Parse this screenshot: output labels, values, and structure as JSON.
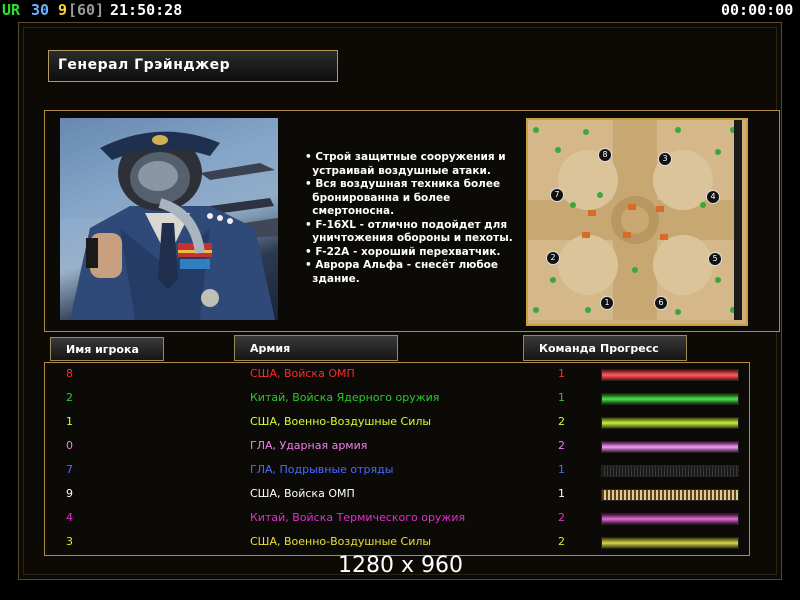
{
  "topbar": {
    "ur_label": "UR",
    "fps": "30",
    "frames": "9",
    "frames_cap": "[60]",
    "clock": "21:50:28",
    "timer": "00:00:00"
  },
  "general": {
    "name": "Генерал Грэйнджер",
    "description_lines": [
      "• Строй защитные сооружения и",
      "  устраивай воздушные атаки.",
      "• Вся воздушная техника более",
      "  бронированна и более",
      "  смертоносна.",
      "• F-16XL - отлично подойдет для",
      "  уничтожения обороны и пехоты.",
      "• F-22A - хороший перехватчик.",
      "• Аврора Альфа - снесёт любое",
      "  здание."
    ]
  },
  "map": {
    "slots": [
      "1",
      "2",
      "3",
      "4",
      "5",
      "6",
      "7",
      "8"
    ]
  },
  "table": {
    "headers": {
      "player": "Имя игрока",
      "army": "Армия",
      "team": "Команда",
      "progress": "Прогресс"
    },
    "rows": [
      {
        "name": "8",
        "army": "США, Войска ОМП",
        "team": "1",
        "color": "#ff2a2a",
        "progress_style": "red"
      },
      {
        "name": "2",
        "army": "Китай, Войска Ядерного оружия",
        "team": "1",
        "color": "#2ec82e",
        "progress_style": "green"
      },
      {
        "name": "1",
        "army": "США, Военно-Воздушные Силы",
        "team": "2",
        "color": "#d8ff30",
        "progress_style": "lime"
      },
      {
        "name": "0",
        "army": "ГЛА, Ударная армия",
        "team": "2",
        "color": "#f07ef0",
        "progress_style": "pink"
      },
      {
        "name": "7",
        "army": "ГЛА, Подрывные отряды",
        "team": "1",
        "color": "#4a6aff",
        "progress_style": "dark"
      },
      {
        "name": "9",
        "army": "США, Войска ОМП",
        "team": "1",
        "color": "#ffffff",
        "progress_style": "gold"
      },
      {
        "name": "4",
        "army": "Китай, Войска Термического оружия",
        "team": "2",
        "color": "#e030c8",
        "progress_style": "magenta"
      },
      {
        "name": "3",
        "army": "США, Военно-Воздушные Силы",
        "team": "2",
        "color": "#e8e030",
        "progress_style": "yellow"
      }
    ]
  },
  "resolution": "1280 x 960"
}
